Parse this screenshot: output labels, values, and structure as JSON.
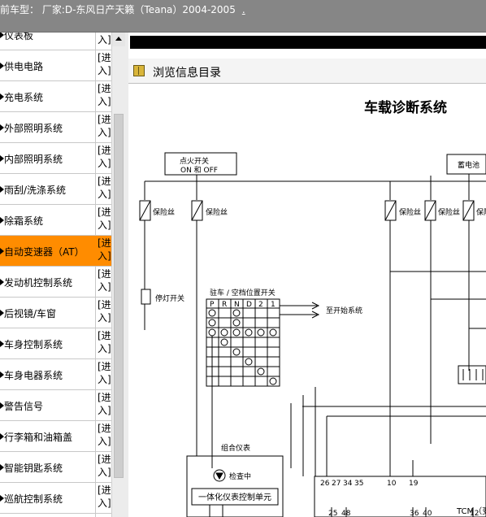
{
  "header": {
    "title": "前车型： 厂家:D-东风日产天籁（Teana）2004-2005",
    "trailing_link": "."
  },
  "sidebar": {
    "enter_label": "[进入]",
    "items": [
      {
        "label": "仪表板"
      },
      {
        "label": "供电电路"
      },
      {
        "label": "充电系统"
      },
      {
        "label": "外部照明系统"
      },
      {
        "label": "内部照明系统"
      },
      {
        "label": "雨刮/洗涤系统"
      },
      {
        "label": "除霜系统"
      },
      {
        "label": "自动变速器（AT）",
        "active": true
      },
      {
        "label": "发动机控制系统"
      },
      {
        "label": "后视镜/车窗"
      },
      {
        "label": "车身控制系统"
      },
      {
        "label": "车身电器系统"
      },
      {
        "label": "警告信号"
      },
      {
        "label": "行李箱和油箱盖"
      },
      {
        "label": "智能钥匙系统"
      },
      {
        "label": "巡航控制系统"
      }
    ]
  },
  "toolbar": {
    "browse_label": "浏览信息目录"
  },
  "diagram": {
    "title": "车载诊断系统",
    "ignition_switch": "点火开关",
    "ignition_state": "ON 和 OFF",
    "battery": "蓄电池",
    "fuse": "保险丝",
    "stop_lamp_switch": "停灯开关",
    "park_neutral_switch": "驻车 / 空档位置开关",
    "gear_labels": [
      "P",
      "R",
      "N",
      "D",
      "2",
      "1"
    ],
    "to_starter": "至开始系统",
    "combination_meter": "组合仪表",
    "check_lamp": "检查中",
    "meter_unit": "一体化仪表控制单元",
    "tcm_label": "TCM（变",
    "top_pins": [
      "26",
      "27",
      "34",
      "35",
      "10",
      "19"
    ],
    "bottom_pins": [
      "25",
      "48",
      "36",
      "40",
      "12"
    ]
  },
  "colors": {
    "header_bg": "#868686",
    "active_item": "#ff8c00",
    "border": "#c8c8c8"
  }
}
